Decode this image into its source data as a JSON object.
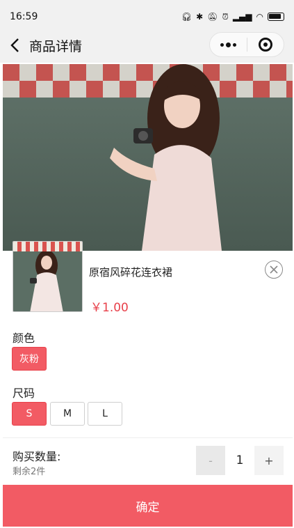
{
  "status_bar": {
    "time": "16:59"
  },
  "nav": {
    "title": "商品详情"
  },
  "product": {
    "name": "原宿风碎花连衣裙",
    "price": "￥1.00"
  },
  "color_section": {
    "label": "颜色",
    "options": [
      "灰粉"
    ],
    "selected": "灰粉"
  },
  "size_section": {
    "label": "尺码",
    "options": [
      "S",
      "M",
      "L"
    ],
    "selected": "S"
  },
  "quantity": {
    "label": "购买数量:",
    "remaining": "剩余2件",
    "value": "1",
    "minus": "-",
    "plus": "+"
  },
  "confirm_label": "确定",
  "colors": {
    "accent": "#f25b64",
    "price": "#e8404a"
  }
}
